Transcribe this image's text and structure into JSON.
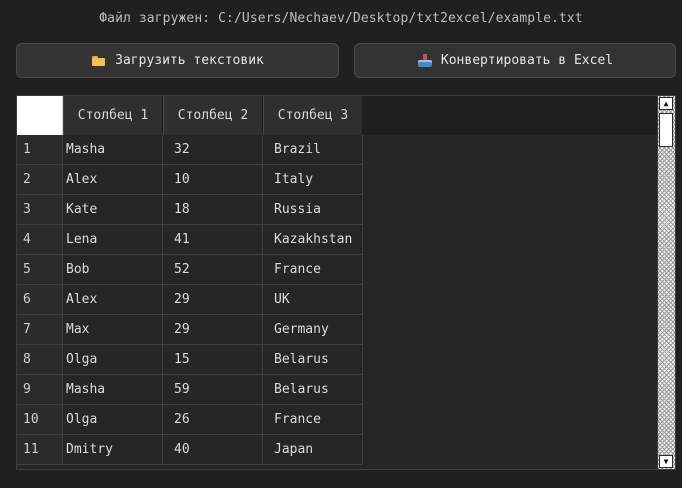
{
  "status": {
    "label": "Файл загружен: C:/Users/Nechaev/Desktop/txt2excel/example.txt"
  },
  "toolbar": {
    "load_label": "Загрузить текстовик",
    "load_icon": "folder-icon",
    "convert_label": "Конвертировать в Excel",
    "convert_icon": "tray-icon"
  },
  "table": {
    "columns": [
      "Столбец 1",
      "Столбец 2",
      "Столбец 3"
    ],
    "rows": [
      {
        "num": "1",
        "c1": "Masha",
        "c2": "32",
        "c3": "Brazil"
      },
      {
        "num": "2",
        "c1": "Alex",
        "c2": "10",
        "c3": "Italy"
      },
      {
        "num": "3",
        "c1": "Kate",
        "c2": "18",
        "c3": "Russia"
      },
      {
        "num": "4",
        "c1": "Lena",
        "c2": "41",
        "c3": "Kazakhstan"
      },
      {
        "num": "5",
        "c1": "Bob",
        "c2": "52",
        "c3": "France"
      },
      {
        "num": "6",
        "c1": "Alex",
        "c2": "29",
        "c3": "UK"
      },
      {
        "num": "7",
        "c1": "Max",
        "c2": "29",
        "c3": "Germany"
      },
      {
        "num": "8",
        "c1": "Olga",
        "c2": "15",
        "c3": "Belarus"
      },
      {
        "num": "9",
        "c1": "Masha",
        "c2": "59",
        "c3": "Belarus"
      },
      {
        "num": "10",
        "c1": "Olga",
        "c2": "26",
        "c3": "France"
      },
      {
        "num": "11",
        "c1": "Dmitry",
        "c2": "40",
        "c3": "Japan"
      }
    ]
  },
  "colors": {
    "background": "#202020",
    "button": "#333333",
    "header_cell": "#2f2f2f"
  }
}
